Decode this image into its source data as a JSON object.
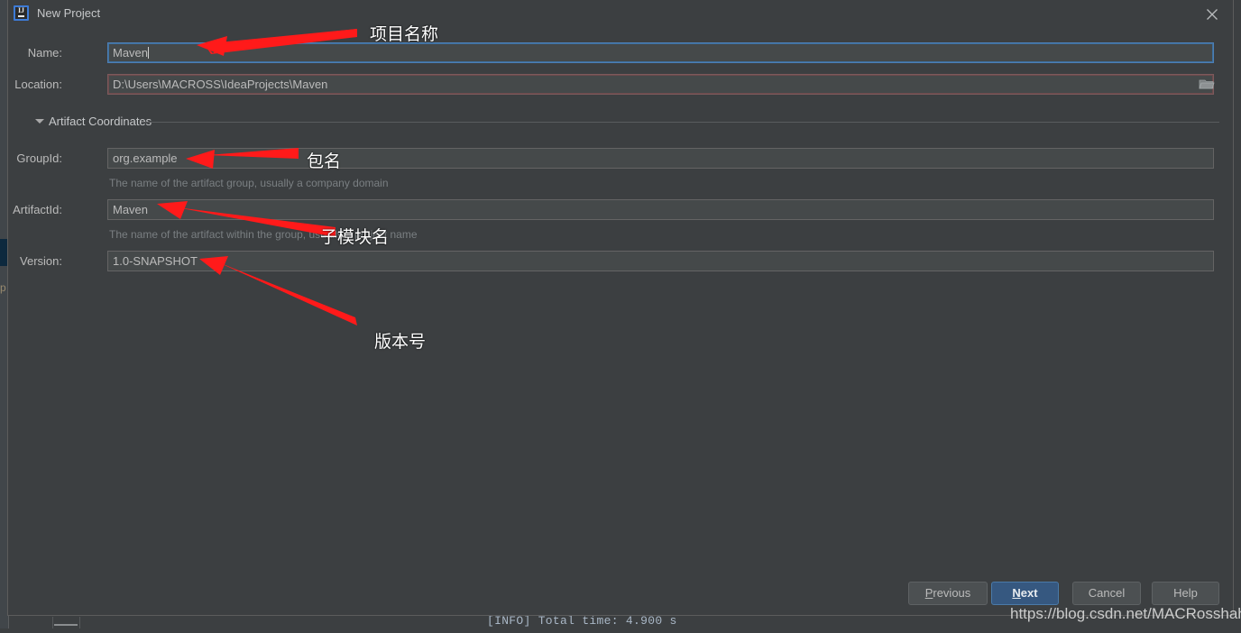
{
  "window": {
    "title": "New Project",
    "app_icon": "intellij-idea-icon",
    "icon_text": "IJ",
    "close_icon": "close-icon"
  },
  "form": {
    "name": {
      "label": "Name:",
      "value": "Maven"
    },
    "location": {
      "label": "Location:",
      "value": "D:\\Users\\MACROSS\\IdeaProjects\\Maven",
      "browse_icon": "folder-browse-icon"
    },
    "section": {
      "title": "Artifact Coordinates",
      "collapse_icon": "chevron-down-icon"
    },
    "group_id": {
      "label": "GroupId:",
      "value": "org.example",
      "hint": "The name of the artifact group, usually a company domain"
    },
    "artifact_id": {
      "label": "ArtifactId:",
      "value": "Maven",
      "hint": "The name of the artifact within the group, usually a project name"
    },
    "version": {
      "label": "Version:",
      "value": "1.0-SNAPSHOT"
    }
  },
  "buttons": {
    "previous": {
      "label": "Previous",
      "mnemonic": "P"
    },
    "next": {
      "label": "Next",
      "mnemonic": "N"
    },
    "cancel": {
      "label": "Cancel"
    },
    "help": {
      "label": "Help"
    }
  },
  "annotations": [
    {
      "id": "project-name",
      "text": "项目名称"
    },
    {
      "id": "package-name",
      "text": "包名"
    },
    {
      "id": "submodule-name",
      "text": "子模块名"
    },
    {
      "id": "version-number",
      "text": "版本号"
    }
  ],
  "background": {
    "console_line": "[INFO] Total time:  4.900 s",
    "gutter_letter": "p"
  },
  "watermark": {
    "text": "https://blog.csdn.net/MACRosshaha"
  },
  "colors": {
    "dialog_bg": "#3c3f41",
    "field_bg": "#45494a",
    "focus_border": "#4d7fb5",
    "warn_border": "#7d5a5c",
    "primary_button": "#365880",
    "annotation_red": "#ff1a1a",
    "text": "#bbbbbb",
    "hint_text": "#7a7f82"
  }
}
